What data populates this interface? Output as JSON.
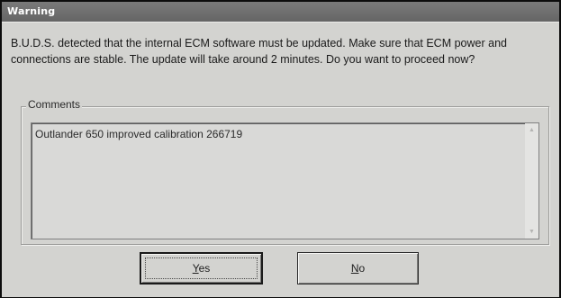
{
  "window": {
    "title": "Warning"
  },
  "message": {
    "line1": "B.U.D.S. detected that the internal ECM software must be updated. Make sure that ECM power and",
    "line2": "connections are stable. The update will take around 2 minutes. Do you want to proceed now?"
  },
  "comments": {
    "label": "Comments",
    "text": "Outlander 650 improved calibration 266719"
  },
  "buttons": {
    "yes_mnemonic": "Y",
    "yes_rest": "es",
    "no_mnemonic": "N",
    "no_rest": "o"
  },
  "icons": {
    "scroll_up": "scroll-up-arrow-icon",
    "scroll_down": "scroll-down-arrow-icon"
  }
}
